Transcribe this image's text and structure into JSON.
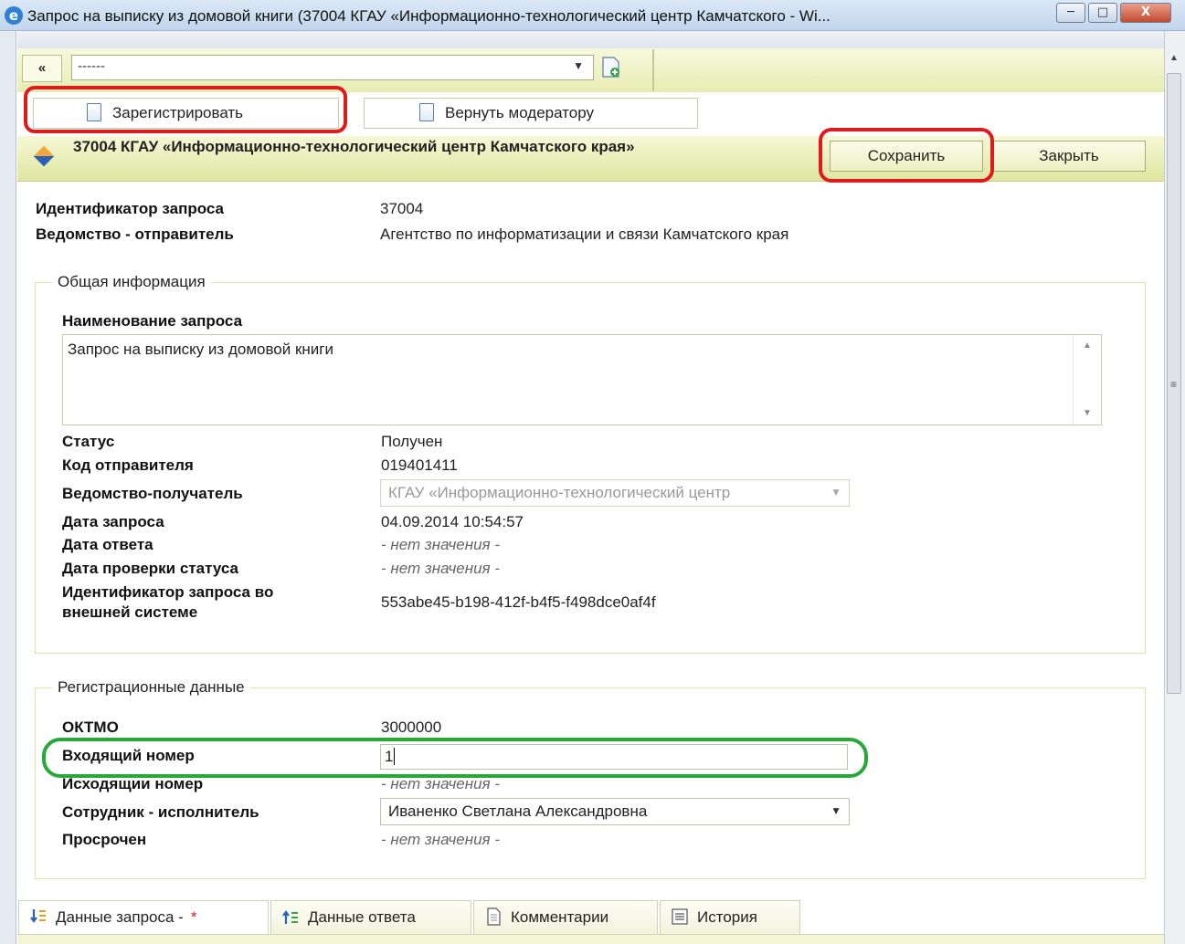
{
  "window": {
    "title": "Запрос на выписку из домовой книги (37004 КГАУ «Информационно-технологический центр Камчатского - Wi...",
    "minimize": "─",
    "maximize": "□",
    "close": "X"
  },
  "toolbar": {
    "collapse": "«",
    "select_value": "------",
    "register_label": "Зарегистрировать",
    "return_label": "Вернуть модератору"
  },
  "header": {
    "title": "37004 КГАУ «Информационно-технологический центр Камчатского края»",
    "save_label": "Сохранить",
    "close_label": "Закрыть"
  },
  "summary": {
    "id_label": "Идентификатор запроса",
    "id_value": "37004",
    "sender_label": "Ведомство - отправитель",
    "sender_value": "Агентство по информатизации и связи Камчатского края"
  },
  "general": {
    "legend": "Общая информация",
    "name_label": "Наименование запроса",
    "name_value": "Запрос на выписку из домовой книги",
    "status_label": "Статус",
    "status_value": "Получен",
    "sender_code_label": "Код отправителя",
    "sender_code_value": "019401411",
    "receiver_label": "Ведомство-получатель",
    "receiver_value": "КГАУ «Информационно-технологический центр",
    "request_date_label": "Дата запроса",
    "request_date_value": "04.09.2014 10:54:57",
    "answer_date_label": "Дата ответа",
    "answer_date_value": "- нет значения -",
    "check_date_label": "Дата проверки статуса",
    "check_date_value": "- нет значения -",
    "ext_id_label_1": "Идентификатор запроса во",
    "ext_id_label_2": "внешней системе",
    "ext_id_value": "553abe45-b198-412f-b4f5-f498dce0af4f"
  },
  "registration": {
    "legend": "Регистрационные данные",
    "oktmo_label": "ОКТМО",
    "oktmo_value": "3000000",
    "incoming_label": "Входящий номер",
    "incoming_value": "1",
    "outgoing_label": "Исходящии номер",
    "outgoing_value": "- нет значения -",
    "employee_label": "Сотрудник - исполнитель",
    "employee_value": "Иваненко Светлана Александровна",
    "overdue_label": "Просрочен",
    "overdue_value": "- нет значения -"
  },
  "tabs": [
    {
      "label": "Данные запроса -",
      "marker": "*"
    },
    {
      "label": "Данные ответа"
    },
    {
      "label": "Комментарии"
    },
    {
      "label": "История"
    }
  ],
  "colors": {
    "annotation_red": "#e0191b",
    "annotation_green": "#27a837",
    "header_band": "#e7ecb2"
  }
}
